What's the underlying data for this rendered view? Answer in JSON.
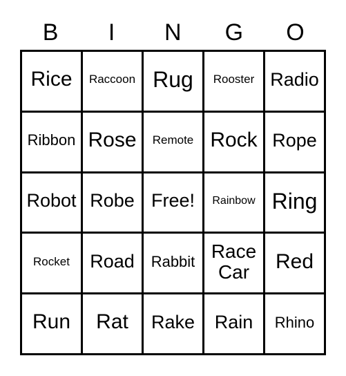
{
  "card": {
    "headers": [
      "B",
      "I",
      "N",
      "G",
      "O"
    ],
    "rows": [
      [
        {
          "label": "Rice",
          "size": "t-lg"
        },
        {
          "label": "Raccoon",
          "size": "t-xs"
        },
        {
          "label": "Rug",
          "size": "t-xl"
        },
        {
          "label": "Rooster",
          "size": "t-xs"
        },
        {
          "label": "Radio",
          "size": "t-md"
        }
      ],
      [
        {
          "label": "Ribbon",
          "size": "t-sm"
        },
        {
          "label": "Rose",
          "size": "t-lg"
        },
        {
          "label": "Remote",
          "size": "t-xs"
        },
        {
          "label": "Rock",
          "size": "t-lg"
        },
        {
          "label": "Rope",
          "size": "t-md"
        }
      ],
      [
        {
          "label": "Robot",
          "size": "t-md"
        },
        {
          "label": "Robe",
          "size": "t-md"
        },
        {
          "label": "Free!",
          "size": "t-md"
        },
        {
          "label": "Rainbow",
          "size": "t-xxs"
        },
        {
          "label": "Ring",
          "size": "t-xl"
        }
      ],
      [
        {
          "label": "Rocket",
          "size": "t-xs"
        },
        {
          "label": "Road",
          "size": "t-md"
        },
        {
          "label": "Rabbit",
          "size": "t-sm"
        },
        {
          "label": "Race\nCar",
          "size": "t-two"
        },
        {
          "label": "Red",
          "size": "t-lg"
        }
      ],
      [
        {
          "label": "Run",
          "size": "t-lg"
        },
        {
          "label": "Rat",
          "size": "t-lg"
        },
        {
          "label": "Rake",
          "size": "t-md"
        },
        {
          "label": "Rain",
          "size": "t-md"
        },
        {
          "label": "Rhino",
          "size": "t-sm"
        }
      ]
    ],
    "free_space": {
      "row": 2,
      "col": 2,
      "label": "Free!"
    },
    "colors": {
      "background": "#ffffff",
      "border": "#000000",
      "text": "#000000"
    }
  }
}
